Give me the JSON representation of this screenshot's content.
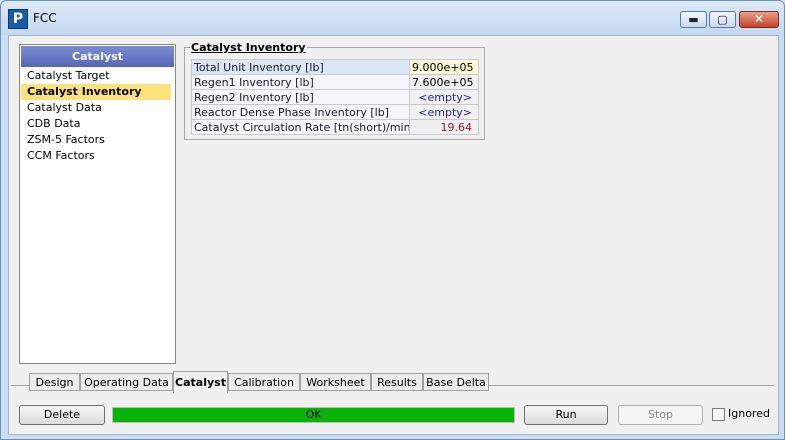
{
  "window": {
    "title": "FCC",
    "app_icon_letter": "P"
  },
  "title_buttons": {
    "minimize": "▬",
    "maximize": "▢",
    "close": "✕"
  },
  "nav": {
    "header": "Catalyst",
    "items": [
      {
        "label": "Catalyst Target"
      },
      {
        "label": "Catalyst Inventory"
      },
      {
        "label": "Catalyst Data"
      },
      {
        "label": "CDB Data"
      },
      {
        "label": "ZSM-5 Factors"
      },
      {
        "label": "CCM Factors"
      }
    ],
    "selected": "Catalyst Inventory"
  },
  "inventory": {
    "title": "Catalyst Inventory",
    "rows": [
      {
        "label": "Total Unit Inventory [lb]",
        "value": "9.000e+05"
      },
      {
        "label": "Regen1 Inventory [lb]",
        "value": "7.600e+05"
      },
      {
        "label": "Regen2 Inventory [lb]",
        "value": "<empty>"
      },
      {
        "label": "Reactor Dense Phase Inventory [lb]",
        "value": "<empty>"
      },
      {
        "label": "Catalyst Circulation Rate [tn(short)/min]",
        "value": "19.64"
      }
    ]
  },
  "tabs": [
    "Design",
    "Operating Data",
    "Catalyst",
    "Calibration",
    "Worksheet",
    "Results",
    "Base Delta"
  ],
  "active_tab": "Catalyst",
  "bottom": {
    "delete_label": "Delete",
    "status_text": "OK",
    "status_progress": 1.0,
    "run_label": "Run",
    "stop_label": "Stop",
    "ignored_label": "Ignored",
    "ignored_checked": false
  },
  "colors": {
    "status_fill": "#06b306",
    "selected_nav": "#fde17a",
    "nav_header": "#6270c0"
  }
}
